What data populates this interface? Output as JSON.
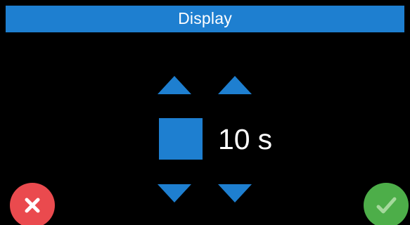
{
  "header": {
    "title": "Display"
  },
  "setting": {
    "value": "10",
    "unit": "s"
  },
  "icons": {
    "cancel": "close-icon",
    "confirm": "checkmark-icon",
    "increase": "triangle-up-icon",
    "decrease": "triangle-down-icon"
  },
  "colors": {
    "accent": "#1e7fd0",
    "background": "#000000",
    "text": "#ffffff",
    "cancel": "#ea4a4e",
    "confirm": "#4dae49"
  }
}
